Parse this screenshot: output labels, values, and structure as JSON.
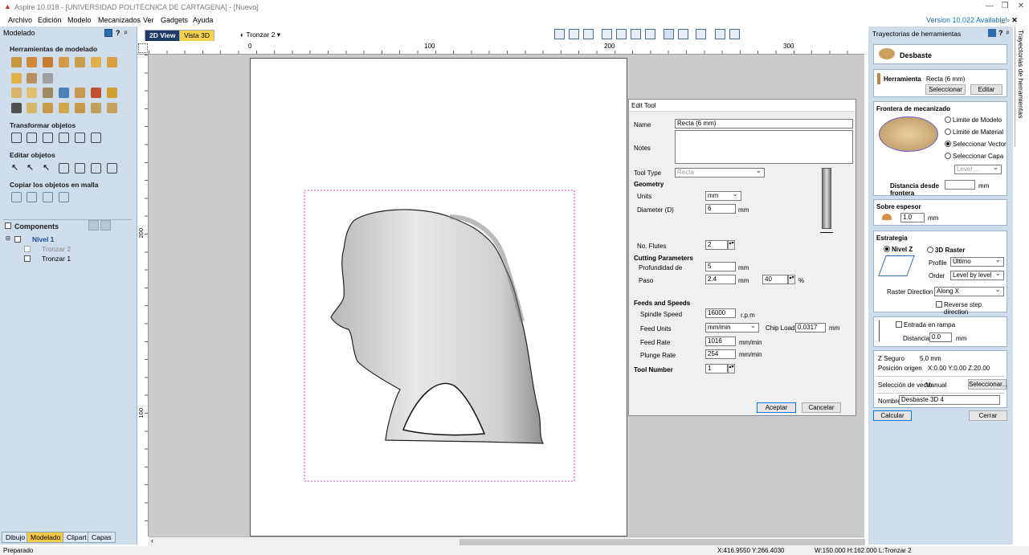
{
  "window": {
    "title": "Aspire 10.018 - [UNIVERSIDAD POLITÉCNICA DE CARTAGENA] - [Nuevo]"
  },
  "menu": {
    "items": [
      "Archivo",
      "Edición",
      "Modelo",
      "Mecanizados",
      "Ver",
      "Gadgets",
      "Ayuda"
    ],
    "version": "Version 10.022 Available!"
  },
  "left": {
    "header": "Modelado",
    "sections": [
      "Herramientas de modelado",
      "Transformar objetos",
      "Editar objetos",
      "Copiar los objetos en malla"
    ],
    "components_title": "Components",
    "tree": [
      "Nivel 1",
      "Tronzar 2",
      "Tronzar 1"
    ],
    "bottom_tabs": [
      "Dibujo",
      "Modelado",
      "Clipart",
      "Capas"
    ]
  },
  "view": {
    "tab_2d": "2D View",
    "tab_3d": "Vista 3D",
    "layer": "Tronzar 2"
  },
  "ruler": {
    "h": [
      "0",
      "100",
      "200",
      "300"
    ],
    "v": [
      "200",
      "100"
    ]
  },
  "dialog": {
    "title": "Edit Tool",
    "name_label": "Name",
    "name_value": "Recta (6 mm)",
    "notes_label": "Notes",
    "tooltype_label": "Tool Type",
    "tooltype_value": "Recta",
    "geometry": "Geometry",
    "units_label": "Units",
    "units_value": "mm",
    "diameter_label": "Diameter (D)",
    "diameter_value": "6",
    "diameter_unit": "mm",
    "flutes_label": "No. Flutes",
    "flutes_value": "2",
    "cutting": "Cutting Parameters",
    "depth_label": "Profundidad de",
    "depth_value": "5",
    "depth_unit": "mm",
    "step_label": "Paso",
    "step_value": "2.4",
    "step_unit": "mm",
    "step_pct": "40",
    "pct": "%",
    "feeds": "Feeds and Speeds",
    "spindle_label": "Spindle Speed",
    "spindle_value": "16000",
    "spindle_unit": "r.p.m",
    "feedunits_label": "Feed Units",
    "feedunits_value": "mm/min",
    "chipload_label": "Chip Load",
    "chipload_value": "0.0317",
    "chipload_unit": "mm",
    "feedrate_label": "Feed Rate",
    "feedrate_value": "1016",
    "feedrate_unit": "mm/min",
    "plunge_label": "Plunge Rate",
    "plunge_value": "254",
    "plunge_unit": "mm/min",
    "toolnum_label": "Tool Number",
    "toolnum_value": "1",
    "ok": "Aceptar",
    "cancel": "Cancelar"
  },
  "right": {
    "header": "Trayectorias de herramientas",
    "op_title": "Desbaste",
    "tool_label": "Herramienta",
    "tool_value": "Recta (6 mm)",
    "select": "Seleccionar",
    "edit": "Editar",
    "boundary_title": "Frontera de mecanizado",
    "b_opts": [
      "Limite de Modelo",
      "Limite de Material",
      "Seleccionar Vector",
      "Seleccionar Capa"
    ],
    "level_placeholder": "Level ...",
    "distance_label": "Distancia desde frontera",
    "mm": "mm",
    "allowance_title": "Sobre espesor",
    "allowance_value": "1.0",
    "strategy_title": "Estrategia",
    "s_z": "Nivel Z",
    "s_raster": "3D Raster",
    "profile_label": "Profile",
    "profile_value": "Último",
    "order_label": "Order",
    "order_value": "Level by level",
    "rdir_label": "Raster Direction",
    "rdir_value": "Along X",
    "reverse": "Reverse step direction",
    "ramp": "Entrada en rampa",
    "ramp_dist_label": "Distancia",
    "ramp_dist_value": "0.0",
    "zsafe": "Z Seguro",
    "zsafe_value": "5.0 mm",
    "origin": "Posición origen",
    "origin_value": "X:0.00 Y:0.00 Z:20.00",
    "vsel_label": "Selección de vecto",
    "vsel_value": "Manual",
    "vsel_btn": "Seleccionar...",
    "name_label": "Nombre",
    "name_value": "Desbaste 3D 4",
    "calc": "Calcular",
    "close": "Cerrar"
  },
  "vtab": "Trayectorias de herramientas",
  "status": {
    "left": "Preparado",
    "coords": "X:416.9550 Y:266.4030",
    "size": "W:150.000  H:162.000  L:Tronzar 2"
  }
}
